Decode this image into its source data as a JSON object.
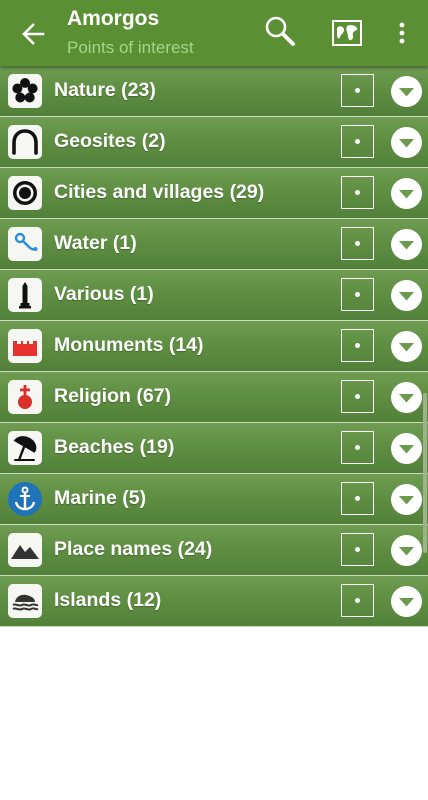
{
  "header": {
    "title": "Amorgos",
    "subtitle": "Points of interest",
    "back_icon": "arrow-left-icon",
    "search_icon": "search-icon",
    "map_icon": "map-icon",
    "menu_icon": "more-vert-icon"
  },
  "colors": {
    "appbar": "#5a8f33",
    "row_top": "#6f9c52",
    "row_bottom": "#52803a",
    "subtitle": "#a9d28a",
    "divider": "#c9dcb9"
  },
  "categories": [
    {
      "label": "Nature (23)",
      "icon": "flower-icon",
      "checked": true
    },
    {
      "label": "Geosites (2)",
      "icon": "arch-icon",
      "checked": true
    },
    {
      "label": "Cities and villages (29)",
      "icon": "target-icon",
      "checked": true
    },
    {
      "label": "Water (1)",
      "icon": "water-pin-icon",
      "checked": true
    },
    {
      "label": "Various (1)",
      "icon": "obelisk-icon",
      "checked": true
    },
    {
      "label": "Monuments (14)",
      "icon": "castle-icon",
      "checked": true
    },
    {
      "label": "Religion (67)",
      "icon": "church-icon",
      "checked": true
    },
    {
      "label": "Beaches (19)",
      "icon": "umbrella-icon",
      "checked": true
    },
    {
      "label": "Marine (5)",
      "icon": "anchor-icon",
      "checked": true
    },
    {
      "label": "Place names (24)",
      "icon": "mountain-icon",
      "checked": true
    },
    {
      "label": "Islands (12)",
      "icon": "island-icon",
      "checked": true
    }
  ]
}
